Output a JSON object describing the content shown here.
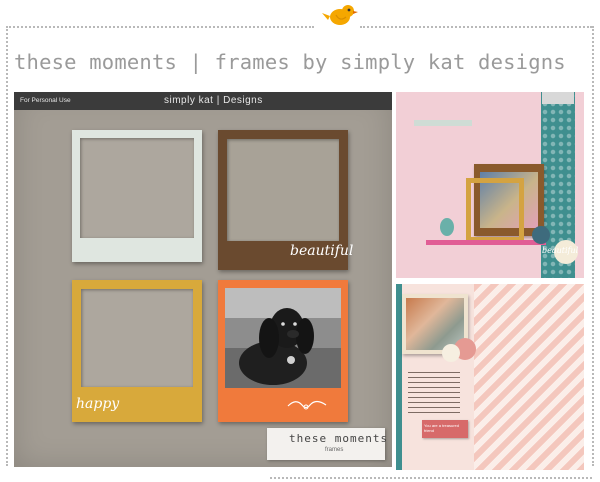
{
  "page": {
    "title": "these moments | frames by simply kat designs"
  },
  "main_card": {
    "personal_use_label": "For Personal Use",
    "brand_label": "simply kat | Designs",
    "frames": [
      {
        "name": "white-frame",
        "caption": ""
      },
      {
        "name": "brown-frame",
        "caption": "beautiful"
      },
      {
        "name": "yellow-frame",
        "caption": "happy"
      },
      {
        "name": "orange-photo-frame",
        "caption": ""
      }
    ],
    "tag_title": "these moments",
    "tag_subtitle": "frames"
  },
  "sample_layouts": {
    "sample1_caption": "beautiful",
    "sample2_note": "You are a treasured friend"
  },
  "colors": {
    "card_bg": "#a39d94",
    "white_frame": "#dfe6e0",
    "brown_frame": "#6a4a2f",
    "yellow_frame": "#d8a93b",
    "orange_frame": "#f07a3c",
    "teal_strip": "#3f8f8f",
    "bird": "#f5a700"
  }
}
